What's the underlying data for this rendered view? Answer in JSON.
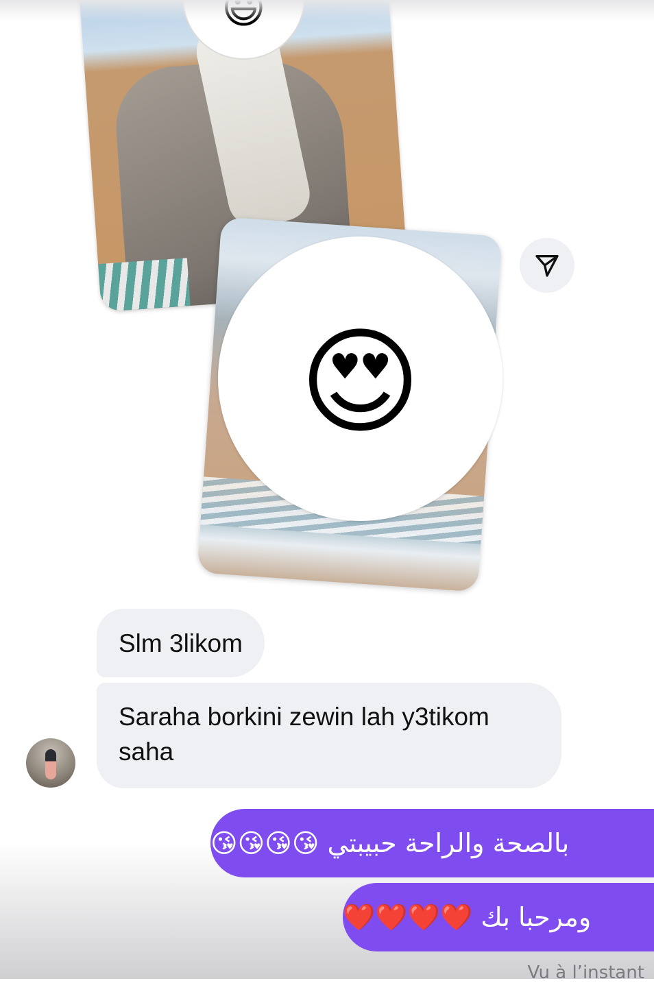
{
  "shared_media": {
    "photo_top_face_cover_emoji": "😃",
    "photo_front_face_cover_emoji": "😍",
    "share_icon": "paper-plane-icon"
  },
  "messages": [
    {
      "direction": "incoming",
      "text": "Slm 3likom"
    },
    {
      "direction": "incoming",
      "text": "Saraha borkini zewin lah y3tikom saha"
    },
    {
      "direction": "outgoing",
      "text": "بالصحة والراحة حبيبتي 😘😘😘😘"
    },
    {
      "direction": "outgoing",
      "text": "ومرحبا بك ❤️❤️❤️❤️"
    }
  ],
  "status": {
    "seen_label": "Vu à l’instant"
  },
  "colors": {
    "outgoing_bubble": "#7f4cf0",
    "incoming_bubble": "#eff0f3"
  }
}
